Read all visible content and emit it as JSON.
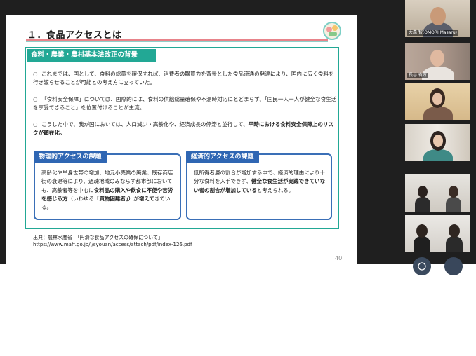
{
  "slide": {
    "title": "１．食品アクセスとは",
    "panel_header": "食料・農業・農村基本法改正の背景",
    "bullets": [
      {
        "mark": "○",
        "text": "これまでは、国として、食料の総量を確保すれば、消費者の購買力を背景とした食品流通の発達により、国内に広く食料を行き渡らせることが可能との考え方に立っていた。"
      },
      {
        "mark": "○",
        "text": "「食料安全保障」については、国際的には、食料の供給総量確保や不測時対応にとどまらず、「国民一人一人が健全な食生活を享受できること」を位置付けることが主流。"
      },
      {
        "mark": "○",
        "text_plain": "こうした中で、我が国においては、人口減少・高齢化や、経済成長の停滞と並行して、",
        "text_bold": "平時における食料安全保障上のリスクが顕在化。"
      }
    ],
    "physical_box": {
      "title": "物理的アクセスの課題",
      "text_1": "高齢化や単身世帯の増加、地元小売業の廃業、既存商店街の衰退等により、過疎地域のみならず都市部においても、高齢者等を中心に",
      "text_bold_1": "食料品の購入や飲食に不便や苦労を感じる方",
      "text_2": "（いわゆる",
      "text_bold_2": "「買物困難者」）が増えて",
      "text_3": "きている。"
    },
    "economic_box": {
      "title": "経済的アクセスの課題",
      "text_1": "低所得者層の割合が増加する中で、経済的理由により十分な食料を入手できず、",
      "text_bold_1": "健全な食生活が実践できていない者の割合が増加している",
      "text_2": "と考えられる。"
    },
    "source_line_1": "出典：農林水産省　「円滑な食品アクセスの確保について」",
    "source_line_2": "https://www.maff.go.jp/j/syouan/access/attach/pdf/index-126.pdf",
    "page_number": "40"
  },
  "participants": [
    {
      "label": "大森 智(OMORI Masaru)"
    },
    {
      "label": "長谷 有方"
    },
    {
      "label": ""
    },
    {
      "label": ""
    },
    {
      "label": ""
    },
    {
      "label": ""
    }
  ],
  "colors": {
    "panel_green": "#22a895",
    "box_blue": "#2f66b3",
    "title_rule_pink": "#e8838a",
    "meeting_bg": "#1f1f1f"
  }
}
